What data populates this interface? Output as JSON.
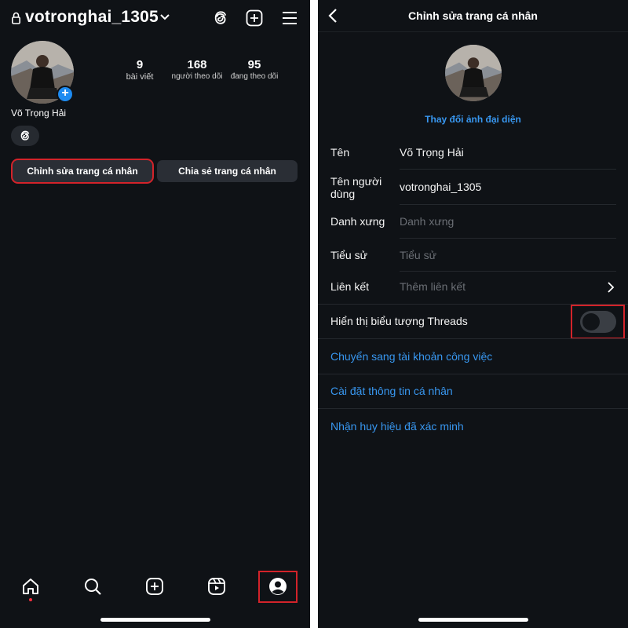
{
  "left": {
    "username": "votronghai_1305",
    "stats": [
      {
        "num": "9",
        "label": "bài viết"
      },
      {
        "num": "168",
        "label": "người theo dõi"
      },
      {
        "num": "95",
        "label": "đang theo dõi"
      }
    ],
    "full_name": "Võ Trọng Hải",
    "buttons": {
      "edit_profile": "Chỉnh sửa trang cá nhân",
      "share_profile": "Chia sẻ trang cá nhân"
    },
    "icons": [
      "lock-icon",
      "chevron-down-icon",
      "threads-icon",
      "new-post-icon",
      "menu-icon",
      "home-icon",
      "search-icon",
      "create-icon",
      "reels-icon",
      "profile-icon"
    ]
  },
  "right": {
    "title": "Chỉnh sửa trang cá nhân",
    "change_photo": "Thay đổi ảnh đại diện",
    "fields": {
      "name": {
        "label": "Tên",
        "value": "Võ Trọng Hải"
      },
      "username": {
        "label": "Tên người dùng",
        "value": "votronghai_1305"
      },
      "pronouns": {
        "label": "Danh xưng",
        "placeholder": "Danh xưng"
      },
      "bio": {
        "label": "Tiểu sử",
        "placeholder": "Tiểu sử"
      },
      "links": {
        "label": "Liên kết",
        "placeholder": "Thêm liên kết"
      }
    },
    "threads_badge": {
      "label": "Hiển thị biểu tượng Threads",
      "enabled": false
    },
    "links": {
      "switch_business": "Chuyển sang tài khoản công việc",
      "personal_info": "Cài đặt thông tin cá nhân",
      "verified": "Nhận huy hiệu đã xác minh"
    }
  },
  "colors": {
    "background": "#0f1216",
    "link": "#3897f0",
    "highlight": "#d3232a",
    "button": "#2a2e35"
  }
}
